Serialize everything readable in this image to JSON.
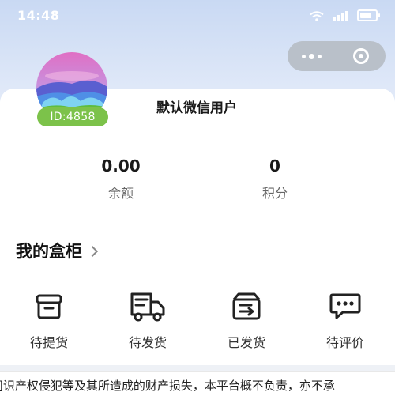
{
  "status_bar": {
    "time": "14:48"
  },
  "profile": {
    "username": "默认微信用户",
    "id_badge": "ID:4858"
  },
  "stats": {
    "balance": {
      "value": "0.00",
      "label": "余额"
    },
    "points": {
      "value": "0",
      "label": "积分"
    }
  },
  "section": {
    "title": "我的盒柜"
  },
  "orders": [
    {
      "label": "待提货",
      "icon": "box-icon"
    },
    {
      "label": "待发货",
      "icon": "truck-icon"
    },
    {
      "label": "已发货",
      "icon": "shipped-box-icon"
    },
    {
      "label": "待评价",
      "icon": "comment-icon"
    }
  ],
  "notice": {
    "text": "]识产权侵犯等及其所造成的财产损失，本平台概不负责，亦不承"
  },
  "colors": {
    "id_badge": "#7cc24a",
    "background": "#eef1f6",
    "capsule": "#b9c0c9"
  }
}
